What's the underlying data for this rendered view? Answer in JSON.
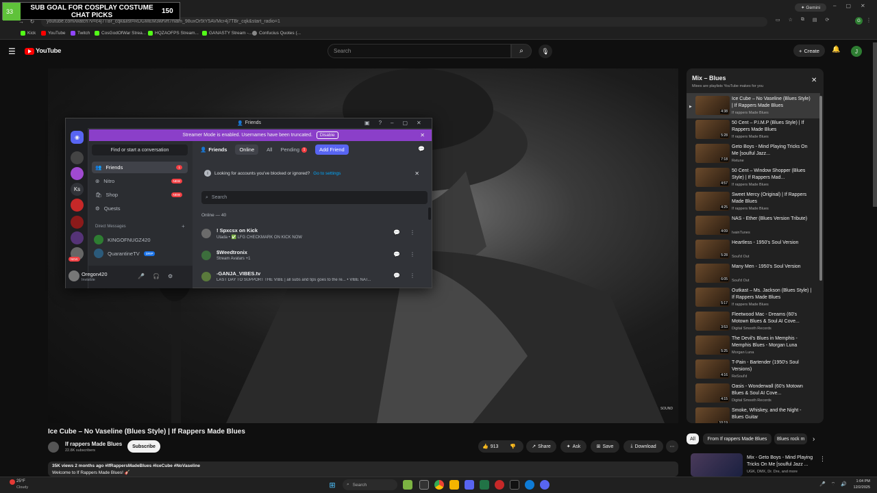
{
  "browser": {
    "url": "youtube.com/watch?v=c4j7TBr_cqk&list=RDGMEM3wrvrt7nlam_98uxOr5tY5AVMcr4j7TBr_cqk&start_radio=1",
    "gemini_label": "Gemini",
    "bookmarks": [
      "Kick",
      "YouTube",
      "Twitch",
      "CosGodOfWar Strea...",
      "HQZAOFPS Stream...",
      "GANASTY Stream -...",
      "Confucius Quotes (..."
    ]
  },
  "stream_overlay": {
    "current": "33",
    "title": "SUB GOAL FOR COSPLAY COSTUME CHAT PICKS",
    "goal": "150"
  },
  "youtube": {
    "logo_text": "YouTube",
    "search_placeholder": "Search",
    "create_label": "Create",
    "avatar_letter": "J",
    "video_watermark": "SOUND",
    "video_title": "Ice Cube – No Vaseline (Blues Style) | If Rappers Made Blues",
    "channel_name": "If rappers Made Blues",
    "subscribers": "22.8K subscribers",
    "subscribe_label": "Subscribe",
    "likes": "913",
    "share_label": "Share",
    "ask_label": "Ask",
    "save_label": "Save",
    "download_label": "Download",
    "desc_meta": "35K views  2 months ago  #IfRappersMadeBlues #IceCube #NoVaseline",
    "desc_line2": "Welcome to If Rappers Made Blues! 🎸",
    "chips": [
      "All",
      "From If rappers Made Blues",
      "Blues rock m"
    ],
    "next_mix_title": "Mix - Geto Boys - Mind Playing Tricks On Me [soulful Jazz ...",
    "next_mix_channel": "UGK, DMX, Dr. Dre, and more"
  },
  "playlist": {
    "title": "Mix – Blues",
    "subtitle": "Mixes are playlists YouTube makes for you",
    "items": [
      {
        "title": "Ice Cube – No Vaseline (Blues Style) | If Rappers Made Blues",
        "channel": "If rappers Made Blues",
        "duration": "4:38"
      },
      {
        "title": "50 Cent – P.I.M.P (Blues Style) | If Rappers Made Blues",
        "channel": "If rappers Made Blues",
        "duration": "5:28"
      },
      {
        "title": "Geto Boys - Mind Playing Tricks On Me [soulful Jazz...",
        "channel": "Retune",
        "duration": "7:18"
      },
      {
        "title": "50 Cent – Window Shopper (Blues Style) | If Rappers Mad...",
        "channel": "If rappers Made Blues",
        "duration": "4:57"
      },
      {
        "title": "Sweet Mercy (Original) | If Rappers Made Blues",
        "channel": "If rappers Made Blues",
        "duration": "4:25"
      },
      {
        "title": "NAS - Ether (Blues Version Tribute)",
        "channel": "IvainTunes",
        "duration": "4:09"
      },
      {
        "title": "Heartless - 1950's Soul Version",
        "channel": "Soul'd Out",
        "duration": "5:28"
      },
      {
        "title": "Many Men - 1950's Soul Version",
        "channel": "Soul'd Out",
        "duration": "6:05"
      },
      {
        "title": "Outkast – Ms. Jackson (Blues Style) | If Rappers Made Blues",
        "channel": "If rappers Made Blues",
        "duration": "5:17"
      },
      {
        "title": "Fleetwood Mac - Dreams (60's Motown Blues & Soul AI Cove...",
        "channel": "Digital Smooth Records",
        "duration": "3:53"
      },
      {
        "title": "The Devil's Blues in Memphis - Memphis Blues - Morgan Luna",
        "channel": "Morgan Luna",
        "duration": "5:25"
      },
      {
        "title": "T-Pain - Bartender (1950's Soul Versions)",
        "channel": "ReSoul'd",
        "duration": "4:16"
      },
      {
        "title": "Oasis - Wonderwall (60's Motown Blues & Soul AI Cove...",
        "channel": "Digital Smooth Records",
        "duration": "4:15"
      },
      {
        "title": "Smoke, Whiskey, and the Night - Blues Guitar",
        "channel": "",
        "duration": "10:19"
      }
    ]
  },
  "discord": {
    "window_title": "Friends",
    "streamer_banner": "Streamer Mode is enabled. Usernames have been truncated.",
    "disable_label": "Disable",
    "find_conversation": "Find or start a conversation",
    "nav": [
      {
        "label": "Friends",
        "badge": "1"
      },
      {
        "label": "Nitro",
        "badge": "NEW"
      },
      {
        "label": "Shop",
        "badge": "NEW"
      },
      {
        "label": "Quests",
        "badge": ""
      }
    ],
    "dm_header": "Direct Messages",
    "dms": [
      {
        "name": "KINGOFNUGZ420",
        "tag": ""
      },
      {
        "name": "QuarantineTV",
        "tag": "DRIP"
      }
    ],
    "server_ks": "Ks",
    "server_new": "NEW",
    "user_name": "Oregon420",
    "user_status": "Invisible",
    "tabs": {
      "friends": "Friends",
      "online": "Online",
      "all": "All",
      "pending": "Pending",
      "pending_count": "1",
      "add_friend": "Add Friend"
    },
    "notice": "Looking for accounts you've blocked or ignored?",
    "notice_link": "Go to settings",
    "search_placeholder": "Search",
    "online_count": "Online — 40",
    "friends": [
      {
        "name": "! Spxcsx on Kick",
        "status": "Utada • ✅ LFG CHECKMARK ON KICK NOW"
      },
      {
        "name": "$Weedtronix",
        "status": "Stream Avatars +1"
      },
      {
        "name": "-GANJA_VIBES.tv",
        "status": "LAST DAY TO SUPPORT THE VIBE | all subs and tips goes to the re...  • VIBE NAT..."
      }
    ]
  },
  "taskbar": {
    "weather_temp": "25°F",
    "weather_desc": "Cloudy",
    "search_placeholder": "Search",
    "time": "1:04 PM",
    "date": "12/2/2025"
  }
}
